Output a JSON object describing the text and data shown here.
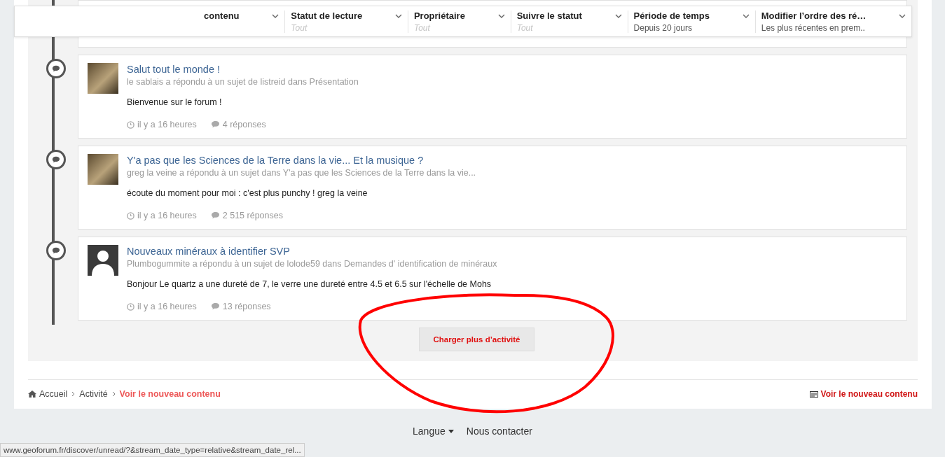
{
  "filters": [
    {
      "label": "contenu"
    },
    {
      "label": "Statut de lecture",
      "value": "Tout",
      "default": true
    },
    {
      "label": "Propriétaire",
      "value": "Tout",
      "default": true
    },
    {
      "label": "Suivre le statut",
      "value": "Tout",
      "default": true
    },
    {
      "label": "Période de temps",
      "value": "Depuis 20 jours",
      "default": false
    },
    {
      "label": "Modifier l’ordre des ré…",
      "value": "Les plus récentes en prem..",
      "default": false
    }
  ],
  "activities": [
    {
      "title": "Salut tout le monde !",
      "summary": "le sablais a répondu à un sujet de listreid dans Présentation",
      "excerpt": "Bienvenue sur le forum !",
      "time": "il y a 16 heures",
      "replies": "4 réponses",
      "kind": "photo"
    },
    {
      "title": "Y'a pas que les Sciences de la Terre dans la vie... Et la musique ?",
      "summary": "greg la veine a répondu à un sujet dans Y'a pas que les Sciences de la Terre dans la vie...",
      "excerpt": "écoute du moment pour moi : c'est plus punchy ! greg la veine",
      "time": "il y a 16 heures",
      "replies": "2 515 réponses",
      "kind": "photo"
    },
    {
      "title": "Nouveaux minéraux à identifier SVP",
      "summary": "Plumbogummite a répondu à un sujet de lolode59 dans Demandes d' identification de minéraux",
      "excerpt": "Bonjour Le quartz a une dureté de 7, le verre une dureté entre 4.5 et 6.5 sur l'échelle de Mohs",
      "time": "il y a 16 heures",
      "replies": "13 réponses",
      "kind": "silhouette"
    }
  ],
  "load_more": "Charger plus d’activité",
  "breadcrumb": [
    {
      "label": "Accueil",
      "current": false,
      "kind": "home"
    },
    {
      "label": "Activité",
      "current": false,
      "kind": "plain"
    },
    {
      "label": "Voir le nouveau contenu",
      "current": true,
      "kind": "plain"
    }
  ],
  "side_link": "Voir le nouveau contenu",
  "footer_links": [
    {
      "label": "Langue",
      "kind": "menu"
    },
    {
      "label": "Nous contacter",
      "kind": "plain"
    }
  ],
  "status_bar": "www.geoforum.fr/discover/unread/?&stream_date_type=relative&stream_date_rel..."
}
